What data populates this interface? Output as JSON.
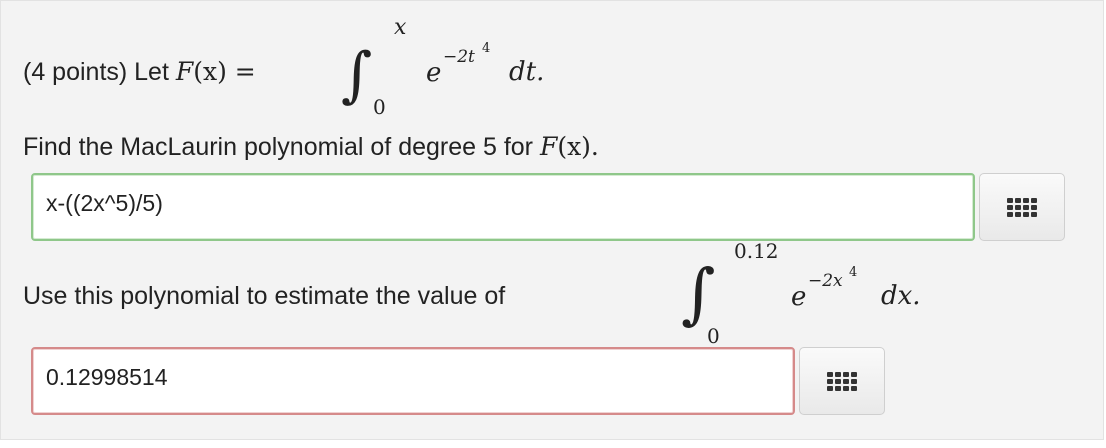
{
  "q1": {
    "lead": "(4 points) Let ",
    "fname": "F",
    "fx": "(x) =",
    "int_upper": "x",
    "int_lower": "0",
    "base": "e",
    "exp": "−2t",
    "exp_pow": "4",
    "diff": "dt."
  },
  "q2": {
    "text": "Find the MacLaurin polynomial of degree 5 for ",
    "fname": "F",
    "fx": "(x)."
  },
  "answer1": {
    "value": "x-((2x^5)/5)",
    "status": "correct"
  },
  "q3": {
    "text": "Use this polynomial to estimate the value of",
    "int_upper": "0.12",
    "int_lower": "0",
    "base": "e",
    "exp": "−2x",
    "exp_pow": "4",
    "diff": "dx."
  },
  "answer2": {
    "value": "0.12998514",
    "status": "incorrect"
  },
  "icons": {
    "keypad": "keypad-grid-icon"
  },
  "colors": {
    "correct_border": "#8fc78a",
    "incorrect_border": "#d58a8a",
    "panel_bg": "#f3f3f3"
  }
}
